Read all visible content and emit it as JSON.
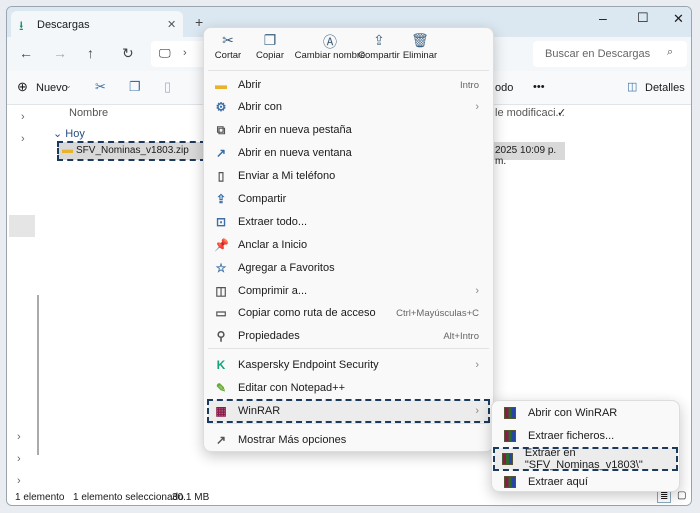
{
  "window": {
    "tab_title": "Descargas",
    "new_tab": "+",
    "minimize": "–",
    "maximize": "☐",
    "close": "✕"
  },
  "address": {
    "search_placeholder": "Buscar en Descargas"
  },
  "toolbar": {
    "new_label": "Nuevo",
    "partial_label": "odo",
    "more": "•••",
    "details_label": "Detalles"
  },
  "columns": {
    "name": "Nombre",
    "modified": "le modificaci..."
  },
  "group": {
    "label": "Hoy"
  },
  "file": {
    "name": "SFV_Nominas_v1803.zip",
    "modified": "2025 10:09 p. m."
  },
  "status": {
    "count": "1 elemento",
    "selected": "1 elemento seleccionado",
    "size": "30.1 MB"
  },
  "context_menu": {
    "top_actions": [
      {
        "label": "Cortar",
        "icon": "cut-icon"
      },
      {
        "label": "Copiar",
        "icon": "copy-icon"
      },
      {
        "label": "Cambiar nombre",
        "icon": "rename-icon"
      },
      {
        "label": "Compartir",
        "icon": "share-icon"
      },
      {
        "label": "Eliminar",
        "icon": "trash-icon"
      }
    ],
    "items": [
      {
        "label": "Abrir",
        "shortcut": "Intro",
        "icon": "folder-icon"
      },
      {
        "label": "Abrir con",
        "submenu": true,
        "icon": "open-with-icon"
      },
      {
        "label": "Abrir en nueva pestaña",
        "icon": "new-tab-icon"
      },
      {
        "label": "Abrir en nueva ventana",
        "icon": "new-window-icon"
      },
      {
        "label": "Enviar a Mi teléfono",
        "icon": "phone-icon"
      },
      {
        "label": "Compartir",
        "icon": "share-icon"
      },
      {
        "label": "Extraer todo...",
        "icon": "extract-icon"
      },
      {
        "label": "Anclar a Inicio",
        "icon": "pin-icon"
      },
      {
        "label": "Agregar a Favoritos",
        "icon": "star-icon"
      },
      {
        "label": "Comprimir a...",
        "submenu": true,
        "icon": "compress-icon"
      },
      {
        "label": "Copiar como ruta de acceso",
        "shortcut": "Ctrl+Mayúsculas+C",
        "icon": "path-icon"
      },
      {
        "label": "Propiedades",
        "shortcut": "Alt+Intro",
        "icon": "wrench-icon"
      },
      {
        "label": "Kaspersky Endpoint Security",
        "submenu": true,
        "icon": "kaspersky-icon"
      },
      {
        "label": "Editar con Notepad++",
        "icon": "notepad-icon"
      },
      {
        "label": "WinRAR",
        "submenu": true,
        "icon": "winrar-icon"
      },
      {
        "label": "Mostrar Más opciones",
        "icon": "more-options-icon"
      }
    ]
  },
  "winrar_submenu": {
    "items": [
      "Abrir con WinRAR",
      "Extraer ficheros...",
      "Extraer en \"SFV_Nominas_v1803\\\"",
      "Extraer aquí"
    ]
  }
}
